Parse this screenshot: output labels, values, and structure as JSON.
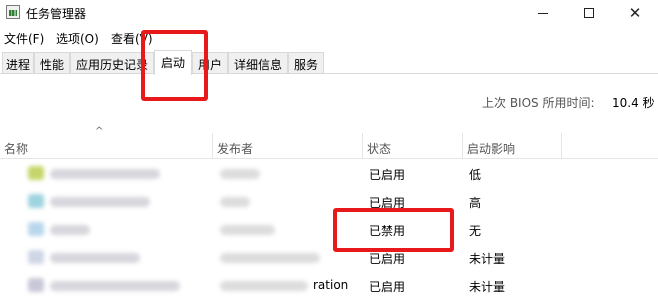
{
  "window": {
    "title": "任务管理器",
    "close_symbol": "✕"
  },
  "menu": {
    "items": [
      "文件(F)",
      "选项(O)",
      "查看(V)"
    ]
  },
  "tabs": [
    "进程",
    "性能",
    "应用历史记录",
    "启动",
    "用户",
    "详细信息",
    "服务"
  ],
  "active_tab": "启动",
  "bios": {
    "label": "上次 BIOS 所用时间:",
    "value": "10.4 秒"
  },
  "table": {
    "sort_indicator": "^",
    "columns": [
      "名称",
      "发布者",
      "状态",
      "启动影响"
    ],
    "rows": [
      {
        "publisher_visible": "",
        "status": "已启用",
        "impact": "低",
        "icon_color": "#c6d66a"
      },
      {
        "publisher_visible": "",
        "status": "已启用",
        "impact": "高",
        "icon_color": "#9fd3e0"
      },
      {
        "publisher_visible": "",
        "status": "已禁用",
        "impact": "无",
        "icon_color": "#b9d7ec"
      },
      {
        "publisher_visible": "",
        "status": "已启用",
        "impact": "未计量",
        "icon_color": "#cfd6e6"
      },
      {
        "publisher_visible": "ration",
        "status": "已启用",
        "impact": "未计量",
        "icon_color": "#c8c8d8"
      }
    ]
  },
  "annotations": {
    "highlight_color": "#e8191a"
  }
}
